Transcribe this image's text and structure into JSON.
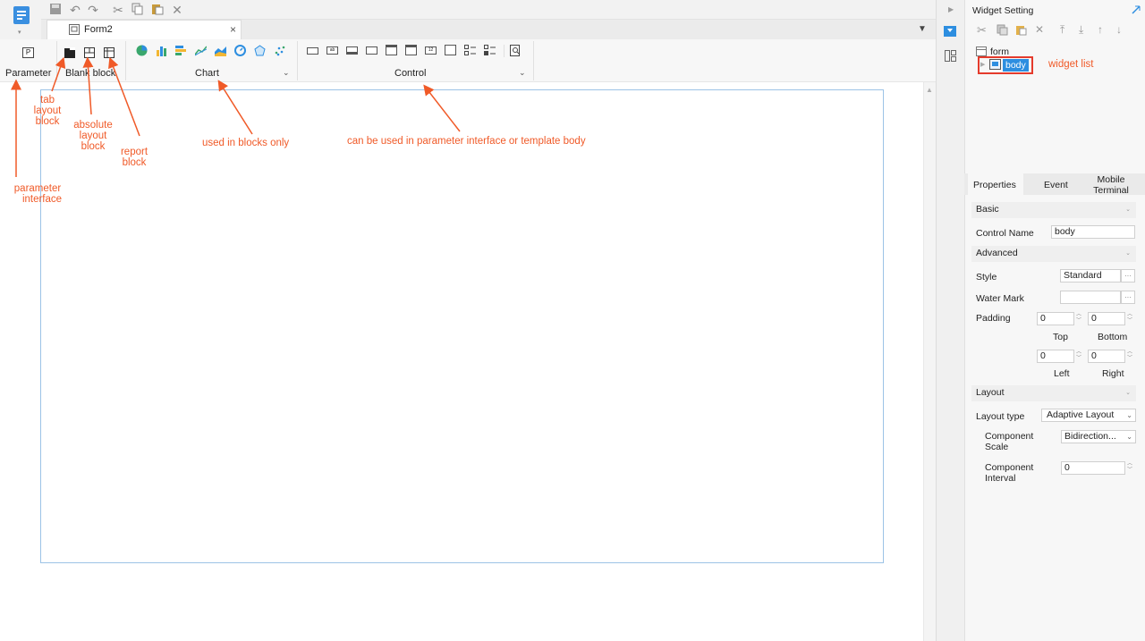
{
  "tab": {
    "title": "Form2",
    "close": "×"
  },
  "toolbar": {
    "parameter_label": "Parameter",
    "blank_block_label": "Blank block",
    "chart_label": "Chart",
    "control_label": "Control"
  },
  "annotations": {
    "tab_layout": [
      "tab",
      "layout",
      "block"
    ],
    "absolute_layout": [
      "absolute",
      "layout",
      "block"
    ],
    "report_block": [
      "report",
      "block"
    ],
    "parameter_interface": [
      "parameter",
      "interface"
    ],
    "chart_note": "used in blocks only",
    "control_note": "can be used in parameter interface or template body",
    "widget_list": "widget list"
  },
  "widget_setting": {
    "title": "Widget Setting",
    "tree": {
      "root": "form",
      "child": "body"
    }
  },
  "properties": {
    "tabs": [
      "Properties",
      "Event",
      "Mobile Terminal"
    ],
    "basic": "Basic",
    "control_name_label": "Control Name",
    "control_name_value": "body",
    "advanced": "Advanced",
    "style_label": "Style",
    "style_value": "Standard",
    "watermark_label": "Water Mark",
    "watermark_value": "",
    "padding_label": "Padding",
    "padding": {
      "top": "0",
      "bottom": "0",
      "left": "0",
      "right": "0"
    },
    "padding_names": {
      "top": "Top",
      "bottom": "Bottom",
      "left": "Left",
      "right": "Right"
    },
    "layout": "Layout",
    "layout_type_label": "Layout type",
    "layout_type_value": "Adaptive Layout",
    "component_scale_label": "Component Scale",
    "component_scale_value": "Bidirection...",
    "component_interval_label": "Component Interval",
    "component_interval_value": "0",
    "ellipsis": "···"
  },
  "colors": {
    "accent": "#2d8ee0",
    "annotation": "#f05a28",
    "highlight_box": "#e53b2c"
  }
}
